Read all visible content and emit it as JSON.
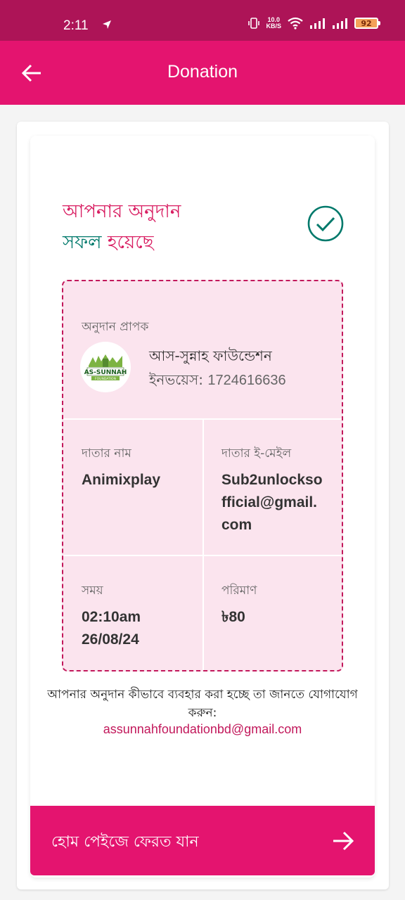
{
  "status_bar": {
    "time": "2:11",
    "net_speed_value": "10.0",
    "net_speed_unit": "KB/S",
    "battery": "92"
  },
  "app_bar": {
    "title": "Donation"
  },
  "success": {
    "line1": "আপনার অনুদান",
    "line2_green": "সফল",
    "line2_rest": " হয়েছে"
  },
  "details": {
    "recipient_label": "অনুদান প্রাপক",
    "recipient_name": "আস-সুন্নাহ ফাউন্ডেশন",
    "invoice_label": "ইনভয়েস:",
    "invoice_number": "1724616636",
    "logo_text": "AS-SUNNAH",
    "logo_subtext": "FOUNDATION",
    "donor_name_label": "দাতার নাম",
    "donor_name": "Animixplay",
    "donor_email_label": "দাতার ই-মেইল",
    "donor_email": "Sub2unlockso fficial@gmail. com",
    "time_label": "সময়",
    "time_value_1": "02:10am",
    "time_value_2": "26/08/24",
    "amount_label": "পরিমাণ",
    "amount_value": "৳80"
  },
  "contact": {
    "note": "আপনার অনুদান কীভাবে ব্যবহার করা হচ্ছে তা জানতে যোগাযোগ করুন:",
    "email": "assunnahfoundationbd@gmail.com"
  },
  "home_button": {
    "label": "হোম পেইজে ফেরত যান"
  },
  "colors": {
    "status_bar": "#ad1457",
    "primary": "#e4146f",
    "success_green": "#00796b",
    "details_bg": "#fbe4ee"
  },
  "icons": {
    "back": "arrow-left-icon",
    "check": "check-circle-icon",
    "forward": "arrow-right-icon"
  }
}
